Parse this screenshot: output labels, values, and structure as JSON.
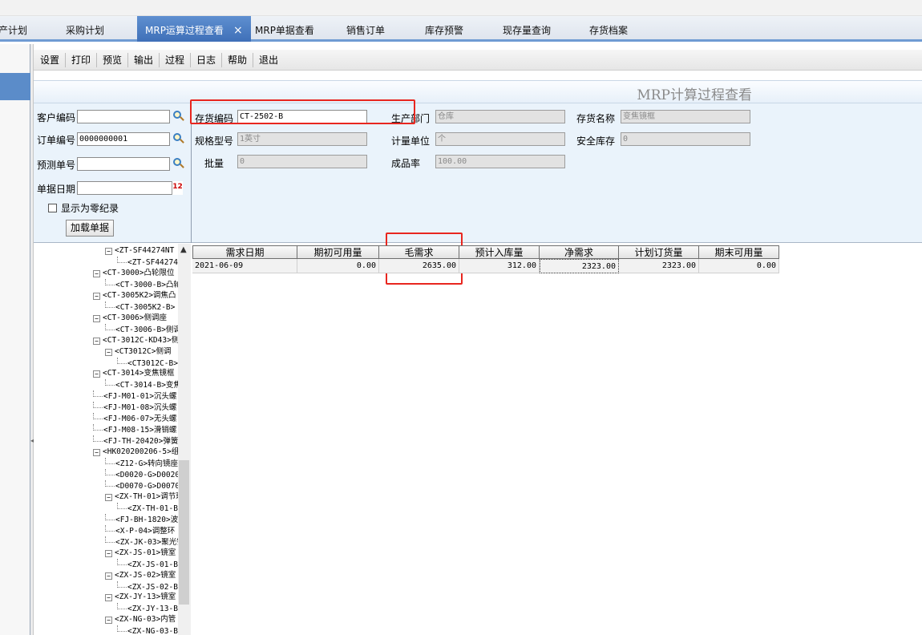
{
  "tabs": [
    {
      "label": "产计划",
      "active": false
    },
    {
      "label": "采购计划",
      "active": false
    },
    {
      "label": "MRP运算过程查看",
      "active": true
    },
    {
      "label": "MRP单据查看",
      "active": false
    },
    {
      "label": "销售订单",
      "active": false
    },
    {
      "label": "库存预警",
      "active": false
    },
    {
      "label": "现存量查询",
      "active": false
    },
    {
      "label": "存货档案",
      "active": false
    }
  ],
  "tab_close": "×",
  "toolbar": [
    "设置",
    "打印",
    "预览",
    "输出",
    "过程",
    "日志",
    "帮助",
    "退出"
  ],
  "page_title": "MRP计算过程查看",
  "filters": {
    "customer_code": {
      "label": "客户编码",
      "value": ""
    },
    "order_no": {
      "label": "订单编号",
      "value": "0000000001"
    },
    "forecast_no": {
      "label": "预测单号",
      "value": ""
    },
    "doc_date": {
      "label": "单据日期",
      "value": "",
      "calendar_glyph": "12"
    },
    "show_zero": {
      "label": "显示为零纪录",
      "checked": false
    },
    "load_button": "加载单据"
  },
  "details": {
    "item_code": {
      "label": "存货编码",
      "value": "CT-2502-B"
    },
    "dept": {
      "label": "生产部门",
      "value": "仓库"
    },
    "item_name": {
      "label": "存货名称",
      "value": "变焦镜框"
    },
    "spec": {
      "label": "规格型号",
      "value": "1英寸"
    },
    "unit": {
      "label": "计量单位",
      "value": "个"
    },
    "safety_stock": {
      "label": "安全库存",
      "value": "0"
    },
    "batch": {
      "label": "批量",
      "value": "0"
    },
    "yield_rate": {
      "label": "成品率",
      "value": "100.00"
    }
  },
  "tree": [
    {
      "depth": 1,
      "exp": true,
      "text": "<ZT-SF44274NT"
    },
    {
      "depth": 2,
      "exp": false,
      "text": "<ZT-SF44274"
    },
    {
      "depth": 0,
      "exp": true,
      "text": "<CT-3000>凸轮限位"
    },
    {
      "depth": 1,
      "exp": false,
      "text": "<CT-3000-B>凸轮"
    },
    {
      "depth": 0,
      "exp": true,
      "text": "<CT-3005K2>调焦凸"
    },
    {
      "depth": 1,
      "exp": false,
      "text": "<CT-3005K2-B>"
    },
    {
      "depth": 0,
      "exp": true,
      "text": "<CT-3006>侧调座"
    },
    {
      "depth": 1,
      "exp": false,
      "text": "<CT-3006-B>侧调"
    },
    {
      "depth": 0,
      "exp": true,
      "text": "<CT-3012C-KD43>侧"
    },
    {
      "depth": 1,
      "exp": true,
      "text": "<CT3012C>侧调"
    },
    {
      "depth": 2,
      "exp": false,
      "text": "<CT3012C-B>"
    },
    {
      "depth": 0,
      "exp": true,
      "text": "<CT-3014>变焦镜框"
    },
    {
      "depth": 1,
      "exp": false,
      "text": "<CT-3014-B>变焦"
    },
    {
      "depth": 0,
      "exp": false,
      "text": "<FJ-M01-01>沉头螺"
    },
    {
      "depth": 0,
      "exp": false,
      "text": "<FJ-M01-08>沉头螺"
    },
    {
      "depth": 0,
      "exp": false,
      "text": "<FJ-M06-07>无头螺"
    },
    {
      "depth": 0,
      "exp": false,
      "text": "<FJ-M08-15>滑销螺"
    },
    {
      "depth": 0,
      "exp": false,
      "text": "<FJ-TH-20420>弹簧"
    },
    {
      "depth": 0,
      "exp": true,
      "text": "<HK020200206-5>组"
    },
    {
      "depth": 1,
      "exp": false,
      "text": "<Z12-G>转向镜座"
    },
    {
      "depth": 1,
      "exp": false,
      "text": "<D0020-G>D0020"
    },
    {
      "depth": 1,
      "exp": false,
      "text": "<D0070-G>D0070"
    },
    {
      "depth": 1,
      "exp": true,
      "text": "<ZX-TH-01>调节环"
    },
    {
      "depth": 2,
      "exp": false,
      "text": "<ZX-TH-01-B"
    },
    {
      "depth": 1,
      "exp": false,
      "text": "<FJ-BH-1820>波纹"
    },
    {
      "depth": 1,
      "exp": false,
      "text": "<X-P-04>调整环"
    },
    {
      "depth": 1,
      "exp": false,
      "text": "<ZX-JK-03>聚光镜"
    },
    {
      "depth": 1,
      "exp": true,
      "text": "<ZX-JS-01>镜室"
    },
    {
      "depth": 2,
      "exp": false,
      "text": "<ZX-JS-01-B"
    },
    {
      "depth": 1,
      "exp": true,
      "text": "<ZX-JS-02>镜室"
    },
    {
      "depth": 2,
      "exp": false,
      "text": "<ZX-JS-02-B"
    },
    {
      "depth": 1,
      "exp": true,
      "text": "<ZX-JY-13>镜室"
    },
    {
      "depth": 2,
      "exp": false,
      "text": "<ZX-JY-13-B"
    },
    {
      "depth": 1,
      "exp": true,
      "text": "<ZX-NG-03>内管"
    },
    {
      "depth": 2,
      "exp": false,
      "text": "<ZX-NG-03-B"
    }
  ],
  "grid": {
    "columns": [
      "需求日期",
      "期初可用量",
      "毛需求",
      "预计入库量",
      "净需求",
      "计划订货量",
      "期末可用量"
    ],
    "rows": [
      [
        "2021-06-09",
        "0.00",
        "2635.00",
        "312.00",
        "2323.00",
        "2323.00",
        "0.00"
      ]
    ]
  }
}
